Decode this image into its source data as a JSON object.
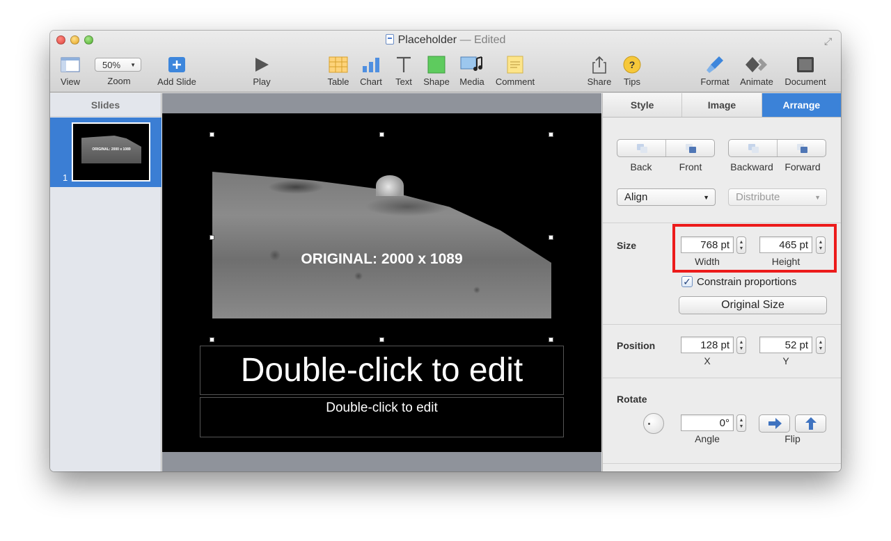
{
  "window": {
    "title": "Placeholder",
    "title_status": "— Edited"
  },
  "toolbar": {
    "view": "View",
    "zoom_value": "50%",
    "zoom": "Zoom",
    "add_slide": "Add Slide",
    "play": "Play",
    "table": "Table",
    "chart": "Chart",
    "text": "Text",
    "shape": "Shape",
    "media": "Media",
    "comment": "Comment",
    "share": "Share",
    "tips": "Tips",
    "format": "Format",
    "animate": "Animate",
    "document": "Document"
  },
  "sidebar": {
    "header": "Slides",
    "slides": [
      {
        "number": "1",
        "thumb_text": "ORIGINAL: 2000 x 1089"
      }
    ]
  },
  "slide": {
    "image_caption": "ORIGINAL: 2000 x 1089",
    "title_placeholder": "Double-click to edit",
    "body_placeholder": "Double-click to edit"
  },
  "inspector": {
    "tabs": {
      "style": "Style",
      "image": "Image",
      "arrange": "Arrange",
      "active": "Arrange"
    },
    "layer": {
      "back": "Back",
      "front": "Front",
      "backward": "Backward",
      "forward": "Forward"
    },
    "align": "Align",
    "distribute": "Distribute",
    "size": {
      "label": "Size",
      "width": "768 pt",
      "width_caption": "Width",
      "height": "465 pt",
      "height_caption": "Height",
      "constrain": "Constrain proportions",
      "constrain_checked": true,
      "original_size": "Original Size"
    },
    "position": {
      "label": "Position",
      "x": "128 pt",
      "x_caption": "X",
      "y": "52 pt",
      "y_caption": "Y"
    },
    "rotate": {
      "label": "Rotate",
      "angle": "0°",
      "angle_caption": "Angle",
      "flip_caption": "Flip"
    }
  },
  "colors": {
    "accent": "#3b82d8",
    "highlight": "#ec1b1b"
  }
}
